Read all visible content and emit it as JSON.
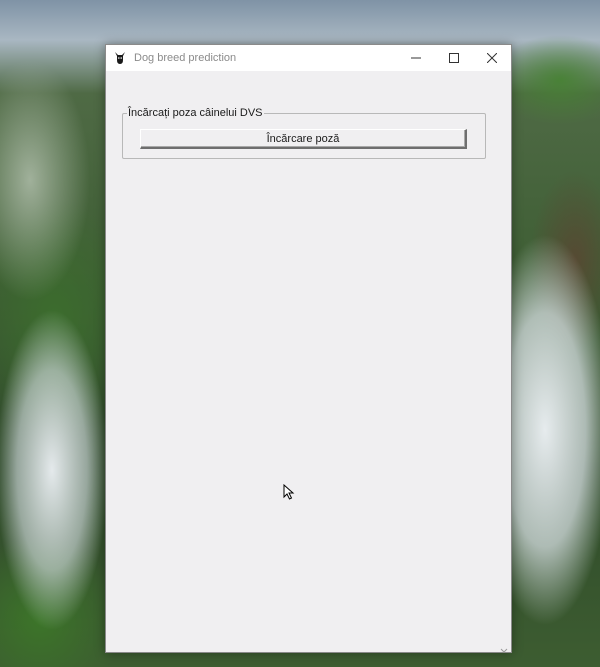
{
  "window": {
    "title": "Dog breed prediction",
    "app_icon": "dog-icon",
    "controls": [
      "minimize-icon",
      "maximize-icon",
      "close-icon"
    ]
  },
  "groupbox": {
    "label": "Încărcați poza câinelui DVS"
  },
  "upload_button": {
    "label": "Încărcare poză"
  },
  "colors": {
    "window_bg": "#f0eff1",
    "titlebar_bg": "#ffffff",
    "title_text": "#8b8b8b"
  }
}
